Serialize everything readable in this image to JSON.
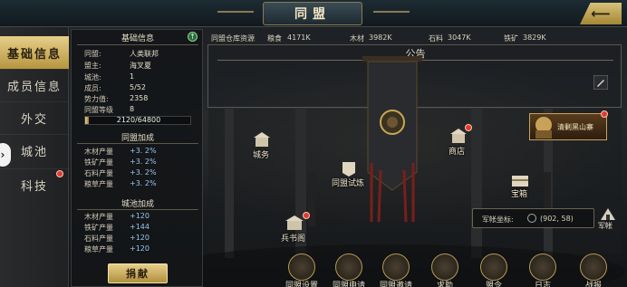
{
  "title": "同盟",
  "nav": {
    "items": [
      {
        "label": "基础信息",
        "active": true
      },
      {
        "label": "成员信息"
      },
      {
        "label": "外交"
      },
      {
        "label": "城池"
      },
      {
        "label": "科技"
      }
    ]
  },
  "info_panel": {
    "basic_title": "基础信息",
    "basic_rows": [
      {
        "key": "同盟:",
        "value": "人类联邦"
      },
      {
        "key": "盟主:",
        "value": "海叉夏"
      },
      {
        "key": "城池:",
        "value": "1"
      },
      {
        "key": "成员:",
        "value": "5/52"
      },
      {
        "key": "势力值:",
        "value": "2358"
      },
      {
        "key": "同盟等级",
        "value": "8"
      }
    ],
    "exp_text": "2120/64800",
    "exp_fraction": 0.0327,
    "bonus_title": "同盟加成",
    "bonus_rows": [
      {
        "key": "木材产量",
        "value": "+3. 2%"
      },
      {
        "key": "铁矿产量",
        "value": "+3. 2%"
      },
      {
        "key": "石料产量",
        "value": "+3. 2%"
      },
      {
        "key": "粮草产量",
        "value": "+3. 2%"
      }
    ],
    "city_title": "城池加成",
    "city_rows": [
      {
        "key": "木材产量",
        "value": "+120"
      },
      {
        "key": "铁矿产量",
        "value": "+144"
      },
      {
        "key": "石料产量",
        "value": "+120"
      },
      {
        "key": "粮草产量",
        "value": "+120"
      }
    ],
    "donate_label": "捐献"
  },
  "warehouse": {
    "label": "同盟仓库资源",
    "items": [
      {
        "name": "粮食",
        "value": "4171K"
      },
      {
        "name": "木材",
        "value": "3982K"
      },
      {
        "name": "石料",
        "value": "3047K"
      },
      {
        "name": "铁矿",
        "value": "3829K"
      }
    ]
  },
  "notice": {
    "title": "公告"
  },
  "scene": {
    "city_affairs": "城务",
    "shop": "商店",
    "trial": "同盟试炼",
    "treasure": "宝箱",
    "library": "兵书阁",
    "boss": "清剿黑山寨",
    "coords_label": "军帐坐标:",
    "coords_value": "(902, 58)",
    "tent": "军帐"
  },
  "bottom": [
    {
      "label": "同盟设置"
    },
    {
      "label": "同盟申请"
    },
    {
      "label": "同盟邀请"
    },
    {
      "label": "求助"
    },
    {
      "label": "盟令"
    },
    {
      "label": "日志"
    },
    {
      "label": "战报"
    }
  ],
  "colors": {
    "accent_gold": "#d7c079",
    "bonus_blue": "#9bc4f2",
    "badge_red": "#e23a2e"
  }
}
